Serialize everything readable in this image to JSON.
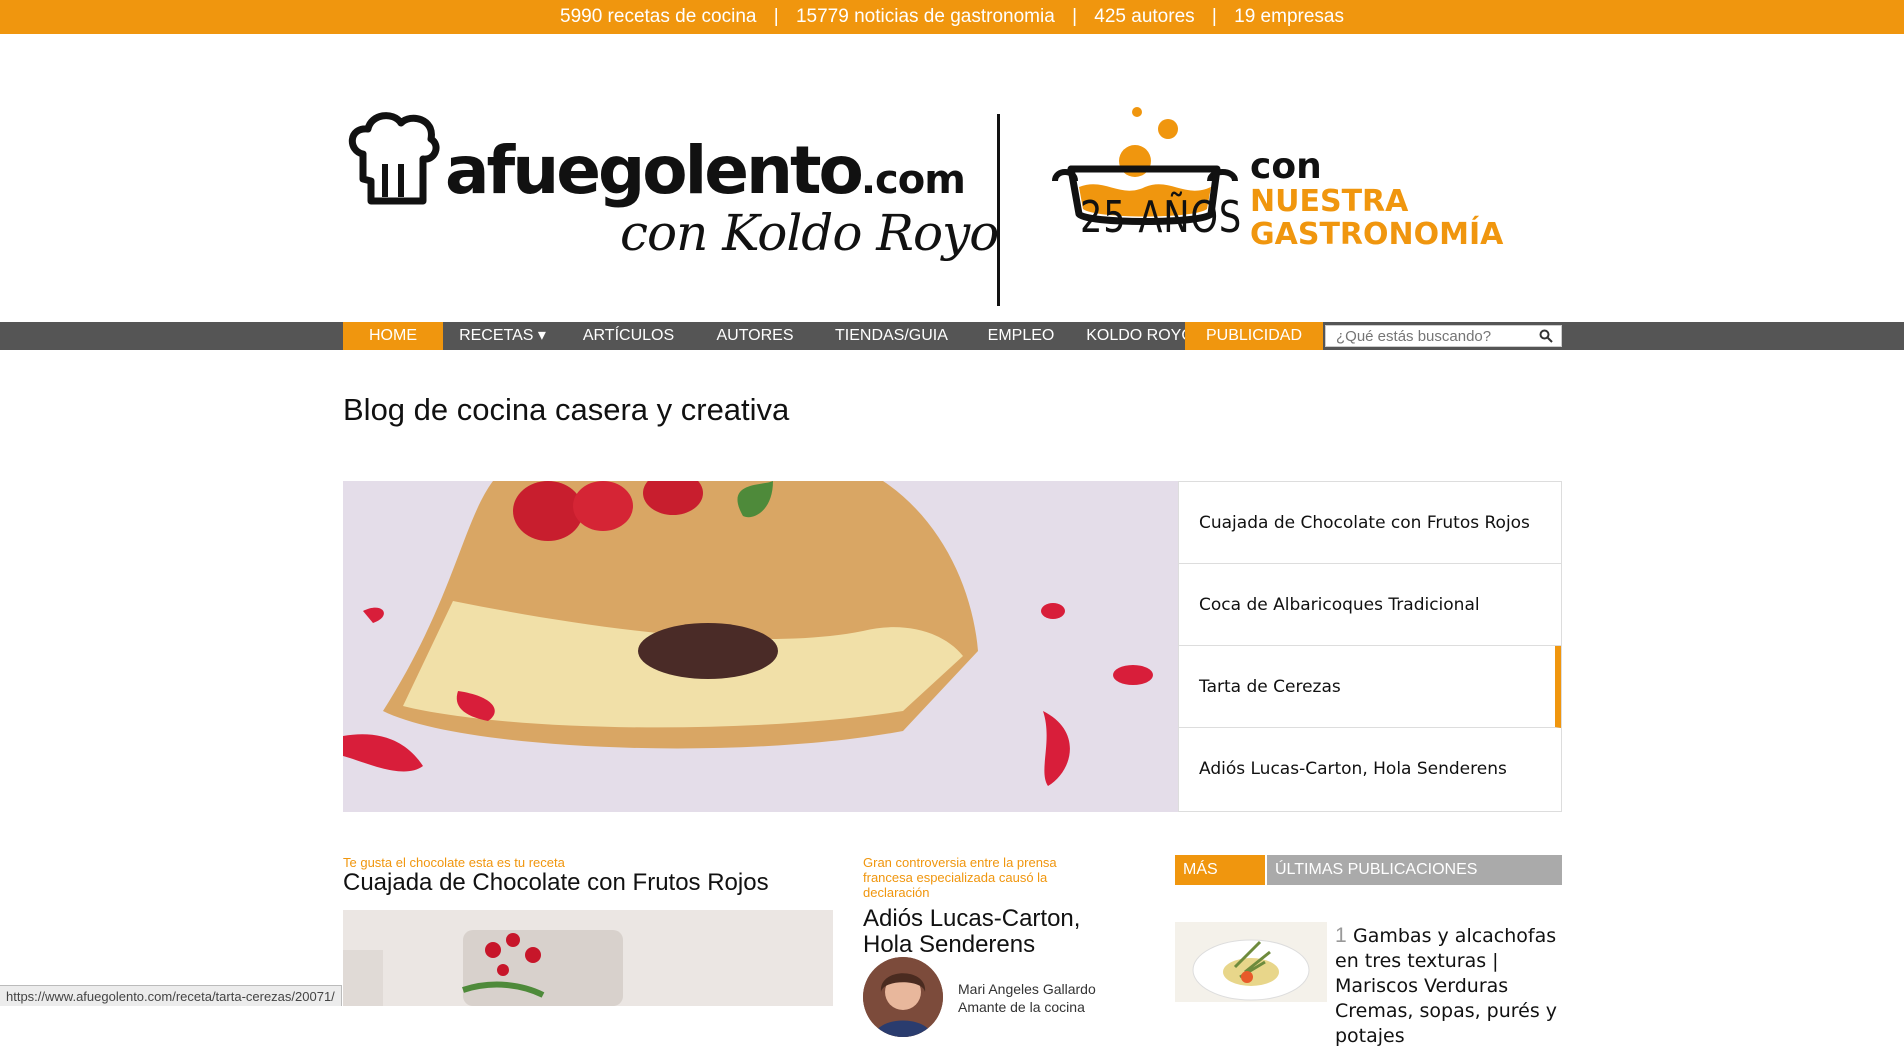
{
  "topbar": {
    "recipes": "5990 recetas de cocina",
    "news": "15779 noticias de gastronomia",
    "authors": "425 autores",
    "companies": "19 empresas",
    "separator": "|"
  },
  "logo": {
    "main": "afuegolento",
    "tld": ".com",
    "tagline": "con Koldo Royo",
    "years": "25 AÑOS",
    "con": "con",
    "nuestra": "NUESTRA",
    "gastronomia": "GASTRONOMÍA"
  },
  "nav": {
    "items": [
      {
        "label": "HOME"
      },
      {
        "label": "RECETAS ▾"
      },
      {
        "label": "ARTÍCULOS"
      },
      {
        "label": "AUTORES"
      },
      {
        "label": "TIENDAS/GUIA"
      },
      {
        "label": "EMPLEO"
      },
      {
        "label": "KOLDO ROYO"
      },
      {
        "label": "PUBLICIDAD"
      }
    ],
    "search_placeholder": "¿Qué estás buscando?"
  },
  "page_title": "Blog de cocina casera y creativa",
  "hero": {
    "items": [
      {
        "label": "Cuajada de Chocolate con Frutos Rojos"
      },
      {
        "label": "Coca de Albaricoques Tradicional"
      },
      {
        "label": "Tarta de Cerezas"
      },
      {
        "label": "Adiós Lucas-Carton, Hola Senderens"
      }
    ]
  },
  "articles": {
    "first": {
      "kicker": "Te gusta el chocolate esta es tu receta",
      "title": "Cuajada de Chocolate con Frutos Rojos"
    },
    "second": {
      "kicker": "Gran controversia entre la prensa francesa especializada causó la declaración",
      "title": "Adiós Lucas-Carton, Hola Senderens",
      "author_name": "Mari Angeles Gallardo",
      "author_desc": "Amante de la cocina"
    }
  },
  "sidebar": {
    "tab_active": "MÁS LEÍDO",
    "tab_inactive": "ÚLTIMAS PUBLICACIONES",
    "items": [
      {
        "num": "1",
        "title": "Gambas y alcachofas en tres texturas | Mariscos Verduras Cremas, sopas, purés y potajes"
      }
    ]
  },
  "status_url": "https://www.afuegolento.com/receta/tarta-cerezas/20071/",
  "colors": {
    "accent": "#f0960e",
    "nav": "#555555"
  }
}
